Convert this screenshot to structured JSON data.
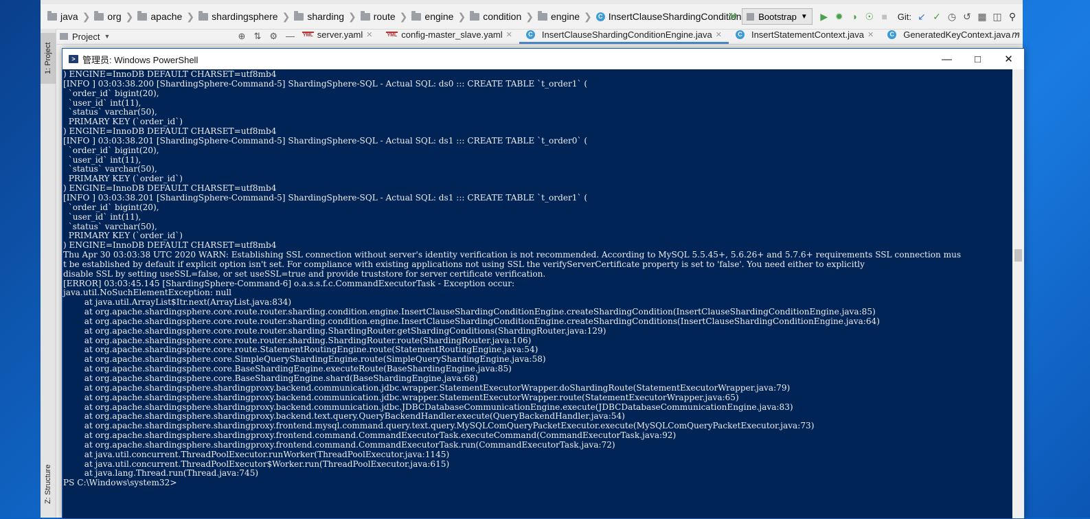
{
  "ide": {
    "breadcrumbs": [
      "java",
      "org",
      "apache",
      "shardingsphere",
      "sharding",
      "route",
      "engine",
      "condition",
      "engine",
      "InsertClauseShardingConditionEngine"
    ],
    "run_config": "Bootstrap",
    "git_label": "Git:",
    "project_label": "Project",
    "left_tabs": {
      "project": "1: Project",
      "structure": "Z: Structure"
    },
    "editor_tabs": [
      {
        "label": "server.yaml",
        "type": "yaml",
        "active": false
      },
      {
        "label": "config-master_slave.yaml",
        "type": "yaml",
        "active": false
      },
      {
        "label": "InsertClauseShardingConditionEngine.java",
        "type": "class",
        "active": true
      },
      {
        "label": "InsertStatementContext.java",
        "type": "class",
        "active": false
      },
      {
        "label": "GeneratedKeyContext.java",
        "type": "class",
        "active": false
      }
    ],
    "tabs_more": "≡1",
    "right_strip_label": "m",
    "colors": {
      "accent": "#4a88c7",
      "class_icon": "#3d9bd8",
      "run": "#4ea04e"
    }
  },
  "powershell": {
    "title": "管理员: Windows PowerShell",
    "background": "#012456",
    "lines": [
      ") ENGINE=InnoDB DEFAULT CHARSET=utf8mb4",
      "[INFO ] 03:03:38.200 [ShardingSphere-Command-5] ShardingSphere-SQL - Actual SQL: ds0 ::: CREATE TABLE `t_order1` (",
      "  `order_id` bigint(20),",
      "  `user_id` int(11),",
      "  `status` varchar(50),",
      "  PRIMARY KEY (`order_id`)",
      ") ENGINE=InnoDB DEFAULT CHARSET=utf8mb4",
      "[INFO ] 03:03:38.201 [ShardingSphere-Command-5] ShardingSphere-SQL - Actual SQL: ds1 ::: CREATE TABLE `t_order0` (",
      "  `order_id` bigint(20),",
      "  `user_id` int(11),",
      "  `status` varchar(50),",
      "  PRIMARY KEY (`order_id`)",
      ") ENGINE=InnoDB DEFAULT CHARSET=utf8mb4",
      "[INFO ] 03:03:38.201 [ShardingSphere-Command-5] ShardingSphere-SQL - Actual SQL: ds1 ::: CREATE TABLE `t_order1` (",
      "  `order_id` bigint(20),",
      "  `user_id` int(11),",
      "  `status` varchar(50),",
      "  PRIMARY KEY (`order_id`)",
      ") ENGINE=InnoDB DEFAULT CHARSET=utf8mb4",
      "Thu Apr 30 03:03:38 UTC 2020 WARN: Establishing SSL connection without server's identity verification is not recommended. According to MySQL 5.5.45+, 5.6.26+ and 5.7.6+ requirements SSL connection mus",
      "t be established by default if explicit option isn't set. For compliance with existing applications not using SSL the verifyServerCertificate property is set to 'false'. You need either to explicitly",
      "disable SSL by setting useSSL=false, or set useSSL=true and provide truststore for server certificate verification.",
      "[ERROR] 03:03:45.145 [ShardingSphere-Command-6] o.a.s.s.f.c.CommandExecutorTask - Exception occur:",
      "java.util.NoSuchElementException: null",
      "        at java.util.ArrayList$Itr.next(ArrayList.java:834)",
      "        at org.apache.shardingsphere.core.route.router.sharding.condition.engine.InsertClauseShardingConditionEngine.createShardingCondition(InsertClauseShardingConditionEngine.java:85)",
      "        at org.apache.shardingsphere.core.route.router.sharding.condition.engine.InsertClauseShardingConditionEngine.createShardingConditions(InsertClauseShardingConditionEngine.java:64)",
      "        at org.apache.shardingsphere.core.route.router.sharding.ShardingRouter.getShardingConditions(ShardingRouter.java:129)",
      "        at org.apache.shardingsphere.core.route.router.sharding.ShardingRouter.route(ShardingRouter.java:106)",
      "        at org.apache.shardingsphere.core.route.StatementRoutingEngine.route(StatementRoutingEngine.java:54)",
      "        at org.apache.shardingsphere.core.SimpleQueryShardingEngine.route(SimpleQueryShardingEngine.java:58)",
      "        at org.apache.shardingsphere.core.BaseShardingEngine.executeRoute(BaseShardingEngine.java:85)",
      "        at org.apache.shardingsphere.core.BaseShardingEngine.shard(BaseShardingEngine.java:68)",
      "        at org.apache.shardingsphere.shardingproxy.backend.communication.jdbc.wrapper.StatementExecutorWrapper.doShardingRoute(StatementExecutorWrapper.java:79)",
      "        at org.apache.shardingsphere.shardingproxy.backend.communication.jdbc.wrapper.StatementExecutorWrapper.route(StatementExecutorWrapper.java:65)",
      "        at org.apache.shardingsphere.shardingproxy.backend.communication.jdbc.JDBCDatabaseCommunicationEngine.execute(JDBCDatabaseCommunicationEngine.java:83)",
      "        at org.apache.shardingsphere.shardingproxy.backend.text.query.QueryBackendHandler.execute(QueryBackendHandler.java:54)",
      "        at org.apache.shardingsphere.shardingproxy.frontend.mysql.command.query.text.query.MySQLComQueryPacketExecutor.execute(MySQLComQueryPacketExecutor.java:73)",
      "        at org.apache.shardingsphere.shardingproxy.frontend.command.CommandExecutorTask.executeCommand(CommandExecutorTask.java:92)",
      "        at org.apache.shardingsphere.shardingproxy.frontend.command.CommandExecutorTask.run(CommandExecutorTask.java:72)",
      "        at java.util.concurrent.ThreadPoolExecutor.runWorker(ThreadPoolExecutor.java:1145)",
      "        at java.util.concurrent.ThreadPoolExecutor$Worker.run(ThreadPoolExecutor.java:615)",
      "        at java.lang.Thread.run(Thread.java:745)",
      "PS C:\\Windows\\system32>"
    ]
  }
}
